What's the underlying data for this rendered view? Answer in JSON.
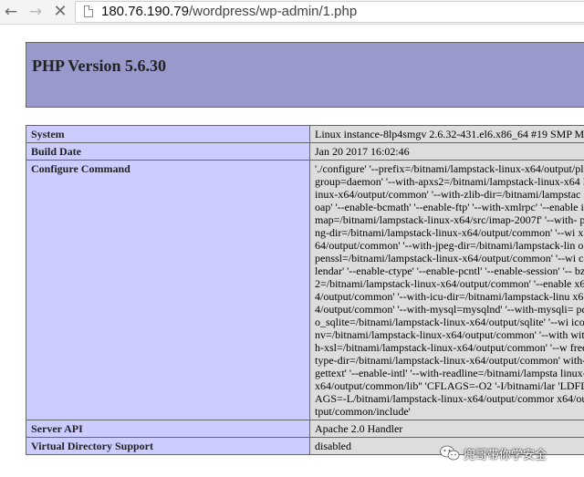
{
  "browser": {
    "url_host": "180.76.190.79",
    "url_path": "/wordpress/wp-admin/1.php",
    "back_icon": "arrow-left-icon",
    "forward_icon": "arrow-right-icon",
    "stop_icon": "close-icon"
  },
  "php": {
    "title": "PHP Version 5.6.30"
  },
  "rows": [
    {
      "key": "System",
      "value": "Linux instance-8lp4smgv 2.6.32-431.el6.x86_64 #19 SMP M"
    },
    {
      "key": "Build Date",
      "value": "Jan 20 2017 16:02:46"
    },
    {
      "key": "Configure Command",
      "value": "'./configure' '--prefix=/bitnami/lampstack-linux-x64/output/pl group=daemon' '--with-apxs2=/bitnami/lampstack-linux-x64 linux-x64/output/common' '--with-zlib-dir=/bitnami/lampstac soap' '--enable-bcmath' '--enable-ftp' '--with-xmlrpc' '--enable imap=/bitnami/lampstack-linux-x64/src/imap-2007f' '--with- png-dir=/bitnami/lampstack-linux-x64/output/common' '--wi x64/output/common' '--with-jpeg-dir=/bitnami/lampstack-lin openssl=/bitnami/lampstack-linux-x64/output/common' '--wi calendar' '--enable-ctype' '--enable-pcntl' '--enable-session' '-- bz2=/bitnami/lampstack-linux-x64/output/common' '--enable x64/output/common' '--with-icu-dir=/bitnami/lampstack-linu x64/output/common' '--with-mysql=mysqlnd' '--with-mysqli= pdo_sqlite=/bitnami/lampstack-linux-x64/output/sqlite' '--wi iconv=/bitnami/lampstack-linux-x64/output/common' '--with with-xsl=/bitnami/lampstack-linux-x64/output/common' '--w freetype-dir=/bitnami/lampstack-linux-x64/output/common' with-gettext' '--enable-intl' '--with-readline=/bitnami/lampsta linux-x64/output/common/lib'' 'CFLAGS=-O2 '-I/bitnami/lar 'LDFLAGS=-L/bitnami/lampstack-linux-x64/output/commor x64/output/common/include'"
    },
    {
      "key": "Server API",
      "value": "Apache 2.0 Handler"
    },
    {
      "key": "Virtual Directory Support",
      "value": "disabled"
    }
  ],
  "watermark": {
    "text": "兜哥带你学安全",
    "icon": "wechat-icon"
  },
  "colors": {
    "header_bg": "#9999cc",
    "key_bg": "#ccccff",
    "value_bg": "#dddddd"
  }
}
